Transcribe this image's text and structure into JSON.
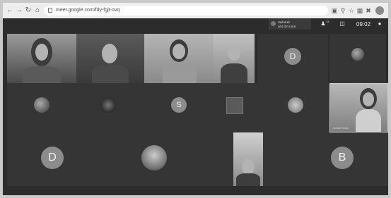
{
  "browser": {
    "url": "meet.google.com/fdy-fgjt-ovq",
    "nav_icons": [
      "back-arrow",
      "forward-arrow",
      "reload",
      "home"
    ],
    "toolbar_icons": [
      "screen-cast",
      "location",
      "star",
      "extensions",
      "puzzle",
      "menu"
    ]
  },
  "meet_header": {
    "presenter_line1": "rasha kk",
    "presenter_line2": "and 42 more",
    "participants_count": "43",
    "time": "09:02"
  },
  "tiles": {
    "avatar_d1": "D",
    "avatar_s": "S",
    "avatar_d2": "D",
    "avatar_b": "B",
    "pinned_name": "Ashim Dutta"
  },
  "colors": {
    "meet_background": "#2c2c2c",
    "tile_background": "#353535",
    "avatar_gray": "#8c8c8c"
  }
}
